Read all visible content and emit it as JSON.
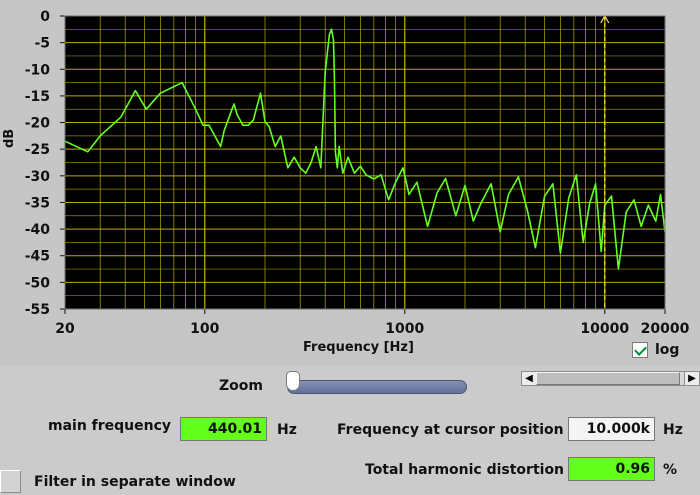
{
  "chart_data": {
    "type": "line",
    "xlabel": "Frequency [Hz]",
    "ylabel": "dB",
    "x_scale": "log",
    "xlim": [
      20,
      20000
    ],
    "ylim": [
      -55,
      0
    ],
    "x_ticks": [
      "20",
      "100",
      "1000",
      "10000",
      "20000"
    ],
    "y_ticks": [
      "0",
      "-5",
      "-10",
      "-15",
      "-20",
      "-25",
      "-30",
      "-35",
      "-40",
      "-45",
      "-50",
      "-55"
    ],
    "cursor_x": 10000,
    "series": [
      {
        "x": [
          20,
          26,
          30,
          38,
          45,
          51,
          60,
          77,
          90,
          98,
          105,
          120,
          125,
          140,
          145,
          155,
          165,
          175,
          190,
          200,
          210,
          225,
          240,
          260,
          280,
          300,
          320,
          340,
          360,
          380,
          400,
          420,
          430,
          440,
          445,
          450,
          460,
          470,
          490,
          520,
          560,
          600,
          640,
          700,
          760,
          830,
          900,
          980,
          1050,
          1150,
          1300,
          1450,
          1600,
          1800,
          2000,
          2200,
          2400,
          2700,
          3000,
          3300,
          3700,
          4100,
          4500,
          5000,
          5500,
          6000,
          6600,
          7200,
          7800,
          8400,
          9000,
          9600,
          10000,
          10800,
          11700,
          12800,
          14000,
          15200,
          16500,
          18000,
          19000,
          20000
        ],
        "values": [
          -23.5,
          -25.5,
          -22.5,
          -19,
          -14,
          -17.5,
          -14.5,
          -12.5,
          -17.5,
          -20.5,
          -20.5,
          -24.5,
          -21.5,
          -16.5,
          -18.5,
          -20.5,
          -20.5,
          -19.5,
          -14.5,
          -19.8,
          -20.8,
          -24.5,
          -22.5,
          -28.5,
          -26.5,
          -28.5,
          -29.5,
          -27.5,
          -24.5,
          -28.5,
          -10.5,
          -3.5,
          -2.5,
          -4.5,
          -12.5,
          -25.5,
          -28.5,
          -24.5,
          -29.5,
          -26.5,
          -29.5,
          -28.2,
          -29.8,
          -30.6,
          -29.8,
          -34.5,
          -31.2,
          -28.5,
          -33.5,
          -31.2,
          -39.5,
          -33.2,
          -30.5,
          -37.5,
          -31.8,
          -38.5,
          -35.2,
          -31.5,
          -40.5,
          -33.5,
          -30.2,
          -36.5,
          -43.5,
          -33.8,
          -31.5,
          -44.5,
          -34.2,
          -29.8,
          -42.5,
          -35.2,
          -31.5,
          -44.2,
          -35.5,
          -33.8,
          -47.5,
          -36.8,
          -34.5,
          -39.5,
          -35.5,
          -38.5,
          -33.5,
          -40.5
        ]
      }
    ]
  },
  "controls": {
    "zoom_label": "Zoom",
    "zoom_value": 0.0,
    "log_label": "log",
    "log_checked": true,
    "scroll_value": 0.98
  },
  "readouts": {
    "main_frequency_label": "main frequency",
    "main_frequency_value": "440.01",
    "main_frequency_unit": "Hz",
    "cursor_frequency_label": "Frequency at cursor position",
    "cursor_frequency_value": "10.000k",
    "cursor_frequency_unit": "Hz",
    "thd_label": "Total harmonic distortion",
    "thd_value": "0.96",
    "thd_unit": "%"
  },
  "filter": {
    "label": "Filter in separate window"
  },
  "colors": {
    "plot_background": "#000000",
    "grid": "#c5b900",
    "trace": "#66ff22",
    "cursor": "#ffe15a"
  }
}
